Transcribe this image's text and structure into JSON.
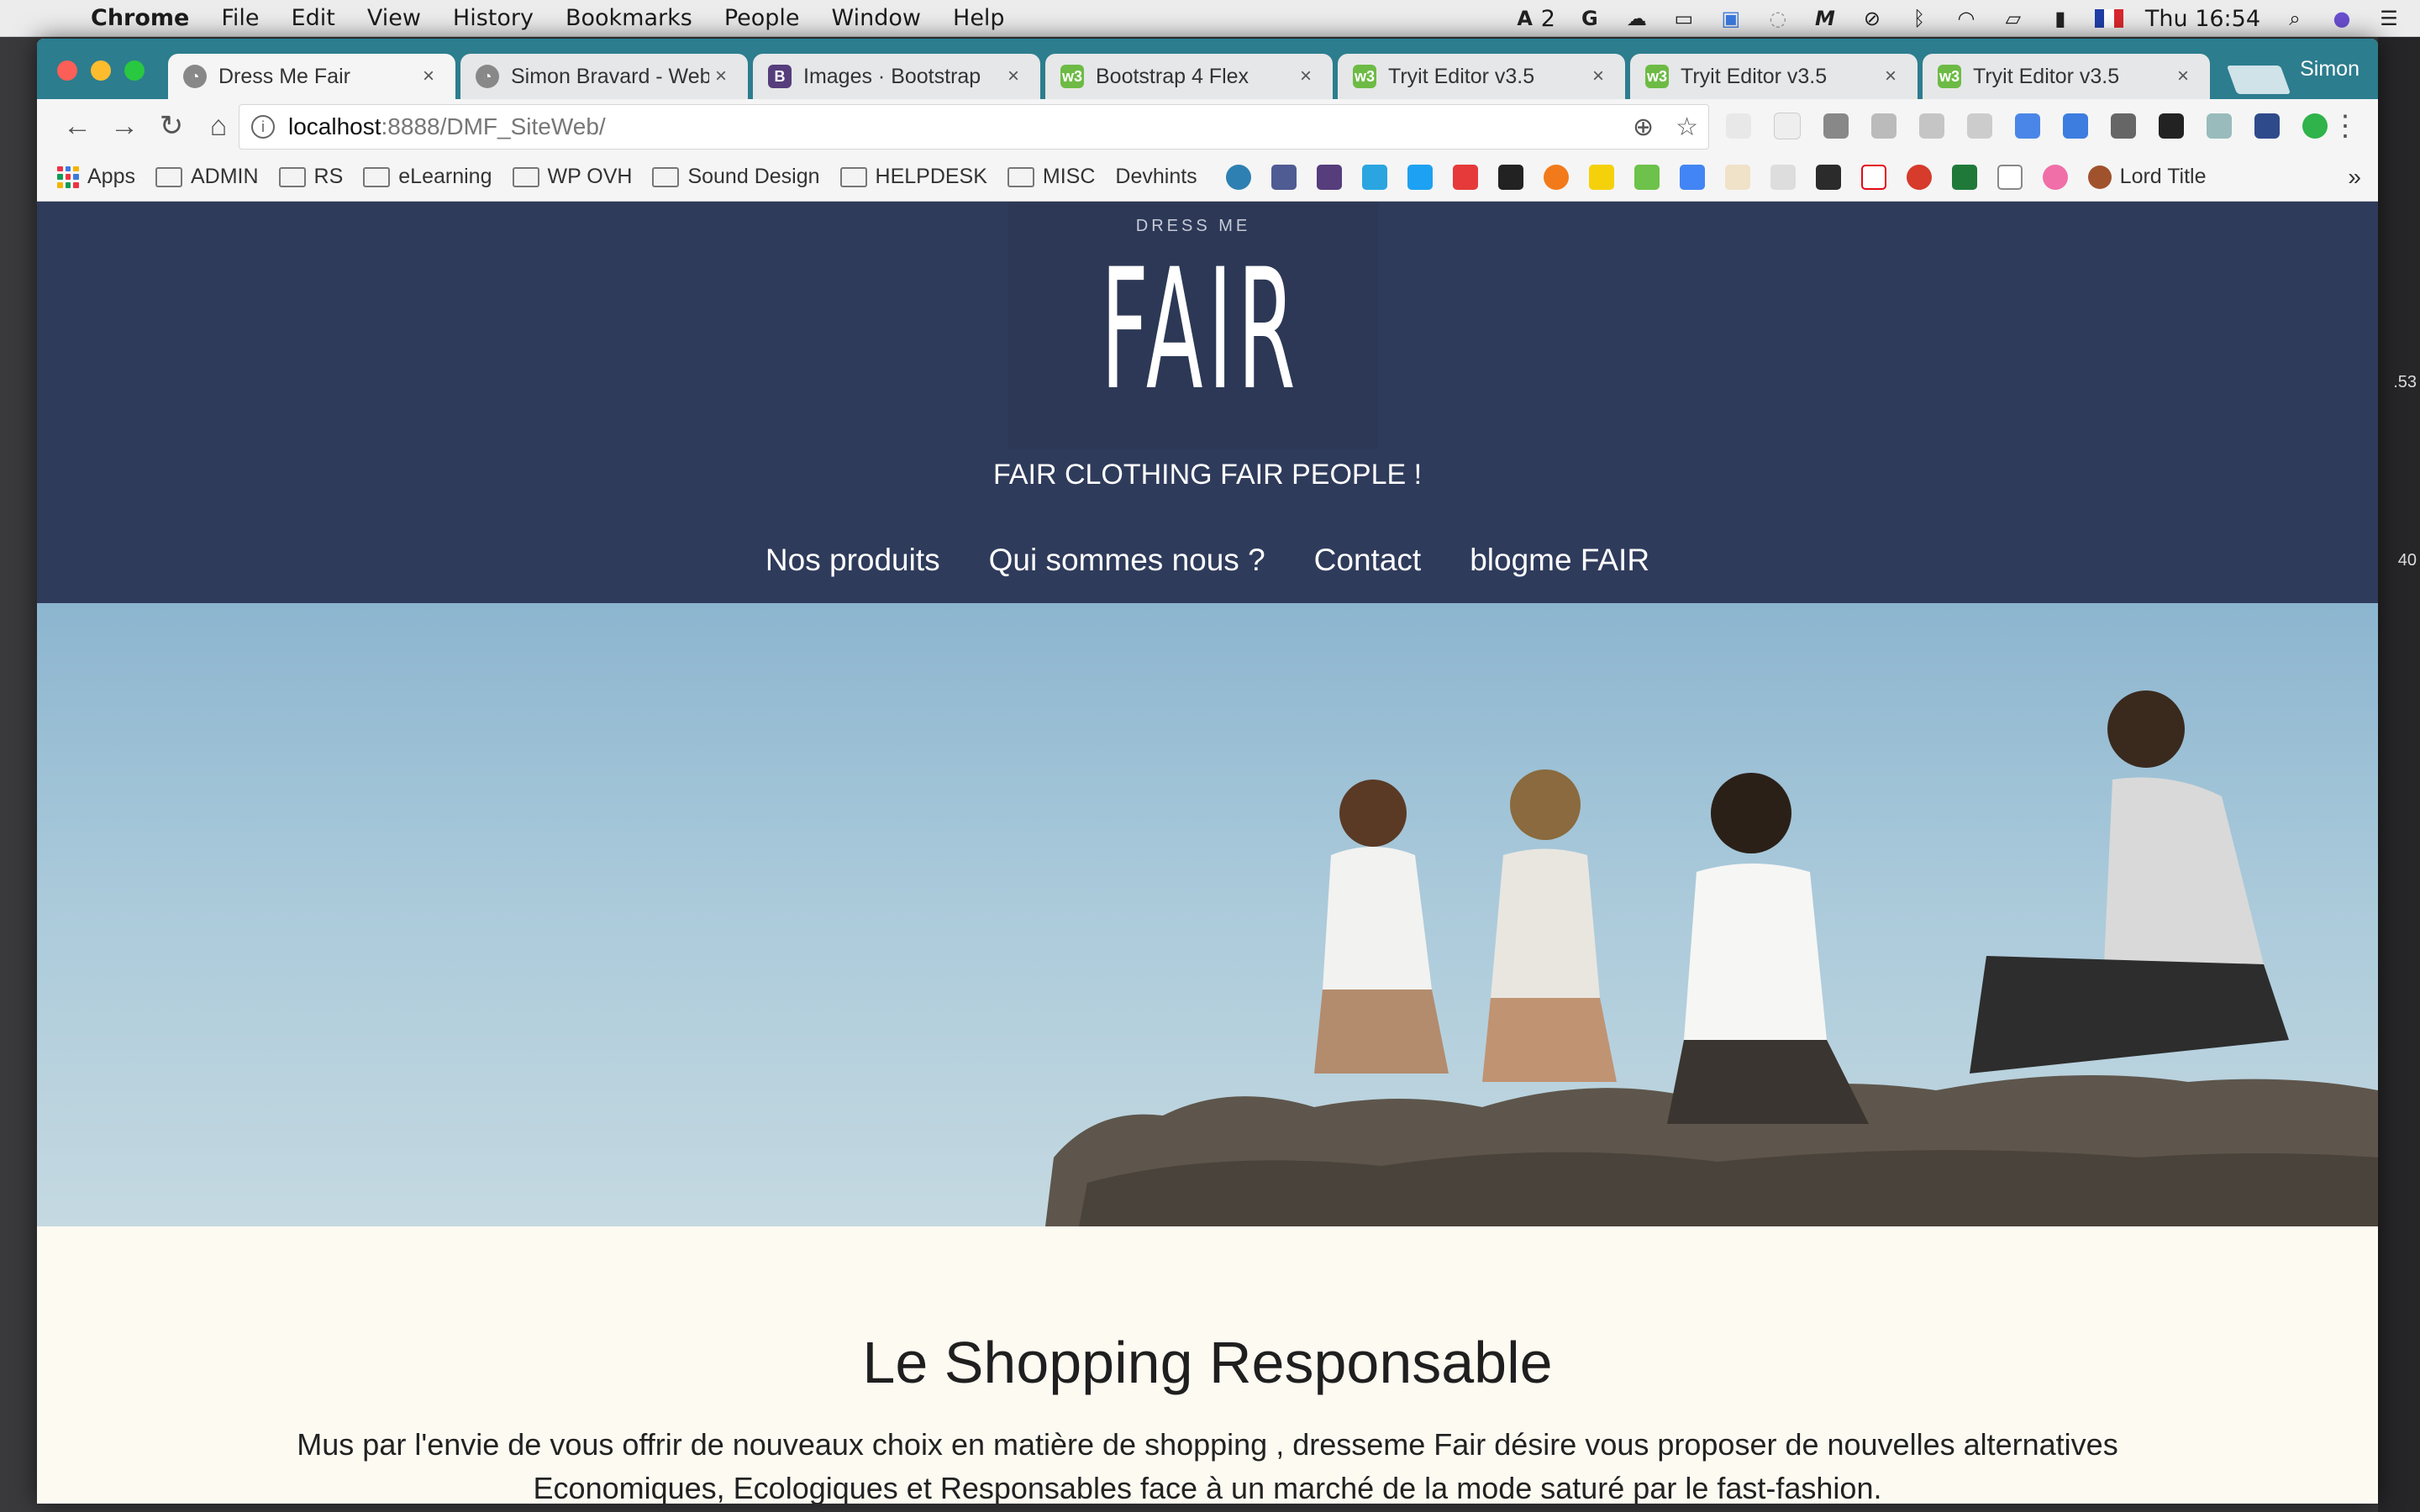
{
  "menubar": {
    "app": "Chrome",
    "items": [
      "File",
      "Edit",
      "View",
      "History",
      "Bookmarks",
      "People",
      "Window",
      "Help"
    ],
    "adobe_badge": "2",
    "clock": "Thu 16:54"
  },
  "desktop": {
    "edge_numbers": [
      ".53",
      "40"
    ]
  },
  "tabs": [
    {
      "label": "Dress Me Fair",
      "icon": "site-icon",
      "active": true
    },
    {
      "label": "Simon Bravard - Web",
      "icon": "site-icon",
      "active": false
    },
    {
      "label": "Images · Bootstrap",
      "icon": "bootstrap-icon",
      "active": false
    },
    {
      "label": "Bootstrap 4 Flex",
      "icon": "w3schools-icon",
      "active": false
    },
    {
      "label": "Tryit Editor v3.5",
      "icon": "w3schools-icon",
      "active": false
    },
    {
      "label": "Tryit Editor v3.5",
      "icon": "w3schools-icon",
      "active": false
    },
    {
      "label": "Tryit Editor v3.5",
      "icon": "w3schools-icon",
      "active": false
    }
  ],
  "profile_name": "Simon",
  "address": {
    "host": "localhost",
    "path": ":8888/DMF_SiteWeb/"
  },
  "bookmarks": {
    "apps_label": "Apps",
    "folders": [
      "ADMIN",
      "RS",
      "eLearning",
      "WP OVH",
      "Sound Design",
      "HELPDESK",
      "MISC"
    ],
    "page_label": "Devhints",
    "last_label": "Lord Title",
    "more": "»"
  },
  "site": {
    "logo_small": "DRESS ME",
    "logo_big": "FAIR",
    "tagline": "FAIR CLOTHING FAIR PEOPLE !",
    "nav": [
      "Nos produits",
      "Qui sommes nous ?",
      "Contact",
      "blogme FAIR"
    ],
    "heading": "Le Shopping Responsable",
    "paragraph": "Mus par l'envie de vous offrir de nouveaux choix en matière de shopping , dresseme Fair désire vous proposer de nouvelles alternatives Economiques, Ecologiques et Responsables face à un marché de la mode saturé par le fast-fashion."
  },
  "colors": {
    "tabstrip": "#2c7d8e",
    "site_header": "#2f3b5b",
    "content_bg": "#fdfaf2"
  }
}
